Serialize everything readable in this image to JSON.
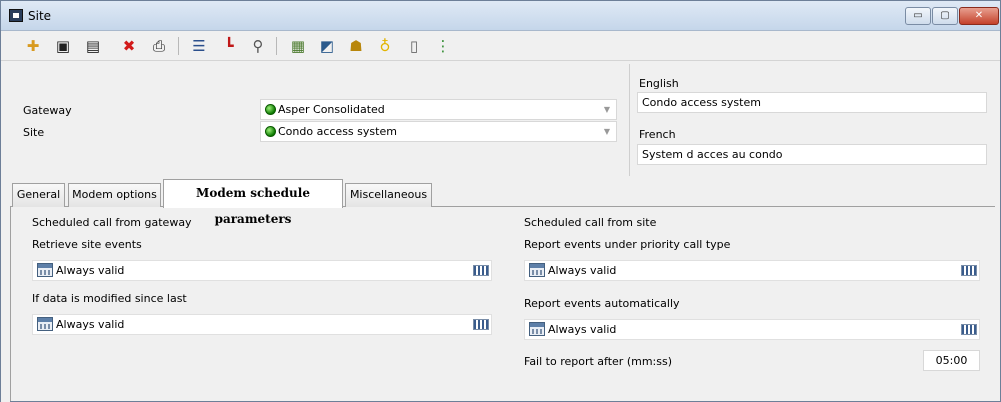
{
  "window": {
    "title": "Site",
    "min_glyph": "▭",
    "max_glyph": "▢",
    "close_glyph": "✕"
  },
  "toolbar": {
    "icons": [
      "new-icon",
      "save-icon",
      "save-as-icon",
      "delete-icon",
      "print-icon",
      "list-icon",
      "hierarchy-icon",
      "search-icon",
      "map-icon",
      "edit-icon",
      "users-icon",
      "bulb-icon",
      "door-icon",
      "status-icon"
    ]
  },
  "header": {
    "gateway_label": "Gateway",
    "gateway_value": "Asper Consolidated",
    "site_label": "Site",
    "site_value": "Condo access system"
  },
  "languages": {
    "english_label": "English",
    "english_value": "Condo access system",
    "french_label": "French",
    "french_value": "System d acces au condo"
  },
  "tabs": [
    {
      "label": "General"
    },
    {
      "label": "Modem options"
    },
    {
      "label": "Modem schedule parameters"
    },
    {
      "label": "Miscellaneous"
    }
  ],
  "gateway_section": {
    "title": "Scheduled call from gateway",
    "retrieve_label": "Retrieve site events",
    "retrieve_value": "Always valid",
    "modified_label": "If data is modified since last",
    "modified_value": "Always valid"
  },
  "site_section": {
    "title": "Scheduled call from site",
    "priority_label": "Report events under priority call type",
    "priority_value": "Always valid",
    "auto_label": "Report events automatically",
    "auto_value": "Always valid",
    "fail_label": "Fail to report after (mm:ss)",
    "fail_value": "05:00"
  },
  "colors": {
    "status_ok": "#0c7a00",
    "title_bar": "#c5d6ea",
    "close_button": "#c4412b"
  }
}
